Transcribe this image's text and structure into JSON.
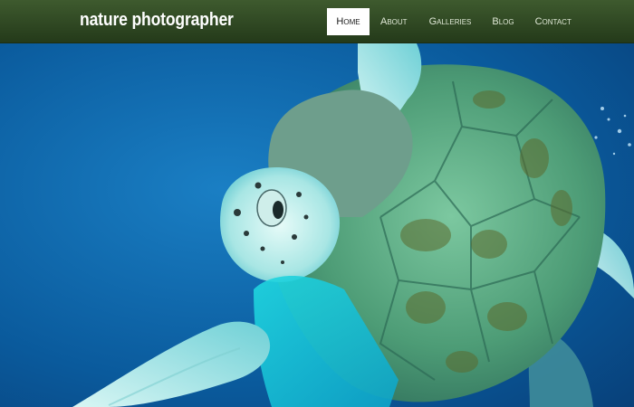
{
  "site": {
    "title": "nature photographer"
  },
  "nav": {
    "items": [
      {
        "label": "Home",
        "active": true
      },
      {
        "label": "About",
        "active": false
      },
      {
        "label": "Galleries",
        "active": false
      },
      {
        "label": "Blog",
        "active": false
      },
      {
        "label": "Contact",
        "active": false
      }
    ]
  },
  "colors": {
    "header_top": "#3e5a2e",
    "header_bottom": "#243a1a",
    "water": "#0a5c9a",
    "turtle_shell": "#4a9a78",
    "turtle_skin": "#7fd6d8"
  }
}
